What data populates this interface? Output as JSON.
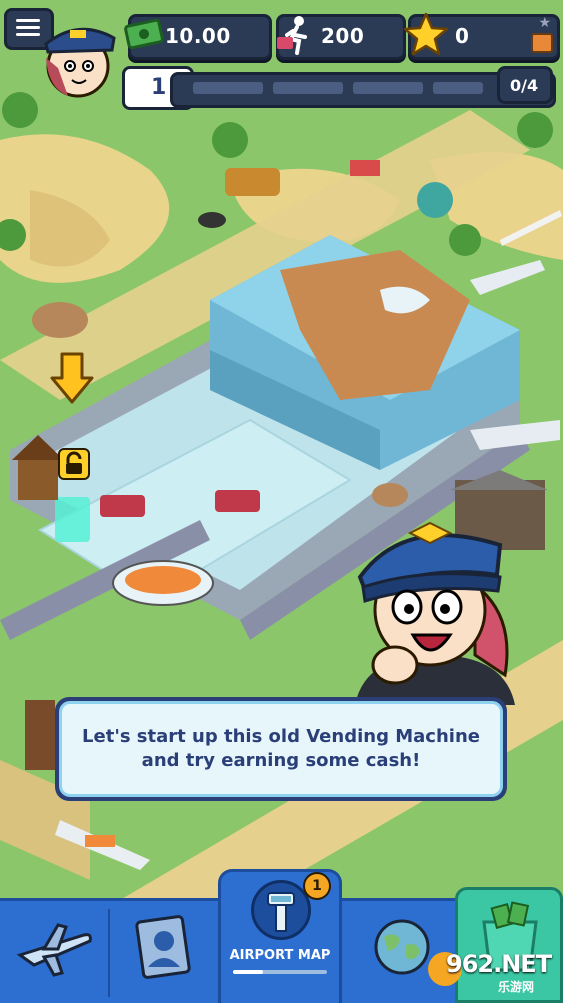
{
  "hud": {
    "cash": "10.00",
    "passengers": "200",
    "stars": "0",
    "level": "1",
    "progress": "0/4",
    "progress_fraction": 0
  },
  "dialog": {
    "text": "Let's start up this old Vending Machine\nand try earning some cash!"
  },
  "nav": {
    "airport_map_label": "AIRPORT MAP",
    "airport_map_badge": "1",
    "items": [
      "planes",
      "staff",
      "airport-map",
      "world",
      "shop"
    ]
  },
  "watermark": {
    "brand": "962.NET",
    "sub": "乐游网"
  },
  "colors": {
    "nav_blue": "#2d6fd1",
    "hud_dark": "#2b3a55",
    "cash_green": "#4caf50",
    "star_yellow": "#ffd02a",
    "dialog_text": "#2a3f78",
    "badge_orange": "#f5a623"
  }
}
